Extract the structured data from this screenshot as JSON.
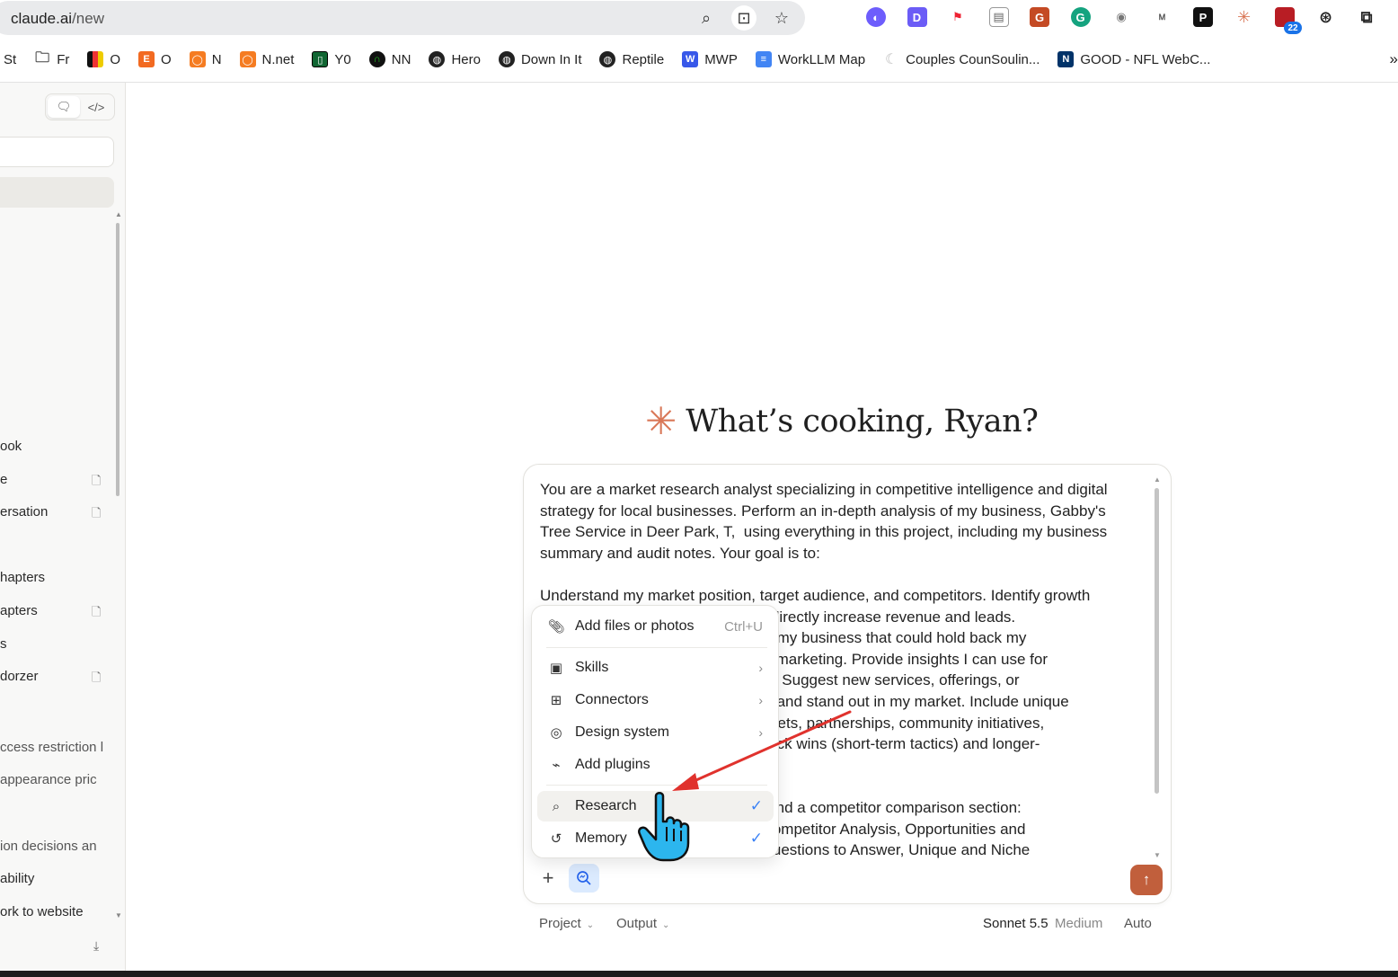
{
  "browser": {
    "url_host": "claude.ai",
    "url_path": "/new",
    "bookmarks": [
      {
        "label": "St",
        "icon": "text-icon"
      },
      {
        "label": "Fr",
        "icon": "folder-icon"
      },
      {
        "label": "O",
        "icon": "flag-icon"
      },
      {
        "label": "O",
        "icon": "e-logo-icon"
      },
      {
        "label": "N",
        "icon": "orange-ring-icon"
      },
      {
        "label": "N.net",
        "icon": "orange-ring-icon"
      },
      {
        "label": "Y0",
        "icon": "terminal-icon"
      },
      {
        "label": "NN",
        "icon": "n-logo-icon"
      },
      {
        "label": "Hero",
        "icon": "globe-icon"
      },
      {
        "label": "Down In It",
        "icon": "globe-icon"
      },
      {
        "label": "Reptile",
        "icon": "globe-icon"
      },
      {
        "label": "MWP",
        "icon": "wordpress-icon"
      },
      {
        "label": "WorkLLM Map",
        "icon": "doc-icon"
      },
      {
        "label": "Couples CounSoulin...",
        "icon": "moon-icon"
      },
      {
        "label": "GOOD - NFL WebC...",
        "icon": "nfl-icon"
      }
    ],
    "extension_badge": "22"
  },
  "sidebar": {
    "items": [
      {
        "label": "ook",
        "has_doc": false
      },
      {
        "label": "e",
        "has_doc": true
      },
      {
        "label": "ersation",
        "has_doc": true
      },
      {
        "label": "hapters",
        "has_doc": false
      },
      {
        "label": "apters",
        "has_doc": true
      },
      {
        "label": "s",
        "has_doc": false
      },
      {
        "label": "dorzer",
        "has_doc": true
      },
      {
        "label": "ccess restriction l",
        "has_doc": false
      },
      {
        "label": "appearance pric",
        "has_doc": false
      },
      {
        "label": "ion decisions an",
        "has_doc": false
      },
      {
        "label": "ability",
        "has_doc": false
      },
      {
        "label": "ork to website",
        "has_doc": false
      }
    ]
  },
  "main": {
    "greeting": "What’s cooking, Ryan?",
    "prompt_text": "You are a market research analyst specializing in competitive intelligence and digital\nstrategy for local businesses. Perform an in-depth analysis of my business, Gabby's\nTree Service in Deer Park, T,  using everything in this project, including my business\nsummary and audit notes. Your goal is to:\n\nUnderstand my market position, target audience, and competitors. Identify growth\n                                        at would directly increase revenue and leads.\n                                        ion about my business that could hold back my\n                                        ile, or my marketing. Provide insights I can use for\n                                        eneration. Suggest new services, offerings, or\n                                        ore leads and stand out in my market. Include unique\n                                        ead magnets, partnerships, community initiatives,\n                                        e both quick wins (short-term tactics) and longer-\n\n\n                                        eadings and a competitor comparison section:\n                                        erview, Competitor Analysis, Opportunities and\n                                        on and Questions to Answer, Unique and Niche",
    "footer": {
      "project_label": "Project",
      "output_label": "Output",
      "model_label": "Sonnet 5.5",
      "effort_label": "Medium",
      "auto_label": "Auto"
    }
  },
  "menu": {
    "items": [
      {
        "label": "Add files or photos",
        "shortcut": "Ctrl+U",
        "icon": "paperclip-icon"
      },
      {
        "label": "Skills",
        "icon": "skills-icon",
        "submenu": true
      },
      {
        "label": "Connectors",
        "icon": "connectors-icon",
        "submenu": true
      },
      {
        "label": "Design system",
        "icon": "palette-icon",
        "submenu": true
      },
      {
        "label": "Add plugins",
        "icon": "plug-icon"
      },
      {
        "label": "Research",
        "icon": "research-icon",
        "checked": true
      },
      {
        "label": "Memory",
        "icon": "memory-icon",
        "checked": true
      }
    ]
  },
  "colors": {
    "accent": "#d97757",
    "send": "#c15f3c",
    "check": "#3b82f6",
    "annotation_arrow": "#e0322d"
  }
}
